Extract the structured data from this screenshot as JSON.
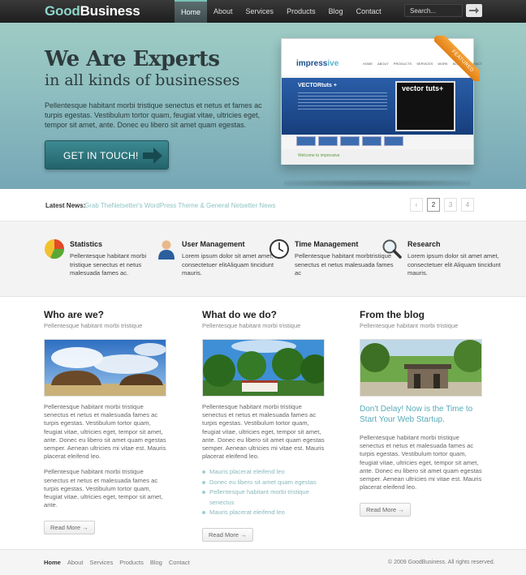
{
  "brand": {
    "part1": "Good",
    "part2": "Business"
  },
  "nav": {
    "items": [
      "Home",
      "About",
      "Services",
      "Products",
      "Blog",
      "Contact"
    ],
    "active": "Home"
  },
  "search": {
    "placeholder": "Search..."
  },
  "hero": {
    "title": "We Are Experts",
    "subtitle": "in all kinds of businesses",
    "text": "Pellentesque habitant morbi tristique senectus et netus et fames ac turpis egestas. Vestibulum tortor quam, feugiat vitae, ultricies eget, tempor sit amet, ante. Donec eu libero sit amet quam egestas.",
    "cta": "GET IN TOUCH!",
    "featured_label": "FEATURED",
    "shot": {
      "logo_a": "impress",
      "logo_b": "ive",
      "nav": [
        "HOME",
        "ABOUT",
        "PRODUCTS",
        "SERVICES",
        "WORK",
        "BLOG",
        "CONTACT"
      ],
      "band_title": "VECTORtuts +",
      "screen_title": "vector tuts+",
      "welcome": "Welcome to impressive"
    }
  },
  "news": {
    "label": "Latest News:",
    "text": "Grab TheNetsetter's WordPress Theme & General Netsetter News",
    "pages": [
      "‹",
      "2",
      "3",
      "4"
    ],
    "current": "2"
  },
  "features": [
    {
      "icon": "pie-chart-icon",
      "title": "Statistics",
      "text": "Pellentesque habitant morbi tristique senectus et netus malesuada fames ac."
    },
    {
      "icon": "user-icon",
      "title": "User Management",
      "text": "Lorem ipsum dolor sit amet amet, consectetuer elitAliquam tincidunt mauris."
    },
    {
      "icon": "clock-icon",
      "title": "Time Management",
      "text": "Pellentesque habitant morbtristique senectus et netus malesuada fames ac"
    },
    {
      "icon": "magnifier-icon",
      "title": "Research",
      "text": "Lorem ipsum dolor sit amet amet, consectetuer elit Aliquam tincidunt mauris."
    }
  ],
  "columns": {
    "who": {
      "title": "Who are we?",
      "subtitle": "Pellentesque habitant morbi tristique",
      "p1": "Pellentesque habitant morbi tristique senectus et netus et malesuada fames ac turpis egestas. Vestibulum tortor quam, feugiat vitae, ultricies eget, tempor sit amet, ante. Donec eu libero sit amet quam egestas semper. Aenean ultricies mi vitae est. Mauris placerat eleifend leo.",
      "p2": "Pellentesque habitant morbi tristique senectus et netus et malesuada fames ac turpis egestas. Vestibulum tortor quam, feugiat vitae, ultricies eget, tempor sit amet, ante.",
      "more": "Read More →"
    },
    "what": {
      "title": "What do we do?",
      "subtitle": "Pellentesque habitant morbi tristique",
      "p1": "Pellentesque habitant morbi tristique senectus et netus et malesuada fames ac turpis egestas. Vestibulum tortor quam, feugiat vitae, ultricies eget, tempor sit amet, ante. Donec eu libero sit amet quam egestas semper. Aenean ultricies mi vitae est. Mauris placerat eleifend leo.",
      "list": [
        "Mauris placerat eleifend leo",
        "Donec eu libero sit amet quam egestas",
        "Pellentesque habitant morbi tristique senectus",
        "Mauris placerat eleifend leo"
      ],
      "more": "Read More →"
    },
    "blog": {
      "title": "From the blog",
      "subtitle": "Pellentesque habitant morbi tristique",
      "post_title": "Don't Delay! Now is the Time to Start Your Web Startup.",
      "p1": "Pellentesque habitant morbi tristique senectus et netus et malesuada fames ac turpis egestas. Vestibulum tortor quam, feugiat vitae, ultricies eget, tempor sit amet, ante. Donec eu libero sit amet quam egestas semper. Aenean ultricies mi vitae est. Mauris placerat eleifend leo.",
      "more": "Read More →"
    }
  },
  "footer": {
    "links": [
      "Home",
      "About",
      "Services",
      "Products",
      "Blog",
      "Contact"
    ],
    "copyright": "© 2009 GoodBusiness. All rights reserved."
  },
  "colors": {
    "accent": "#78c2b6",
    "cta": "#2f7880",
    "link": "#57aab8",
    "topbar": "#262626",
    "featured": "#f0902a"
  }
}
